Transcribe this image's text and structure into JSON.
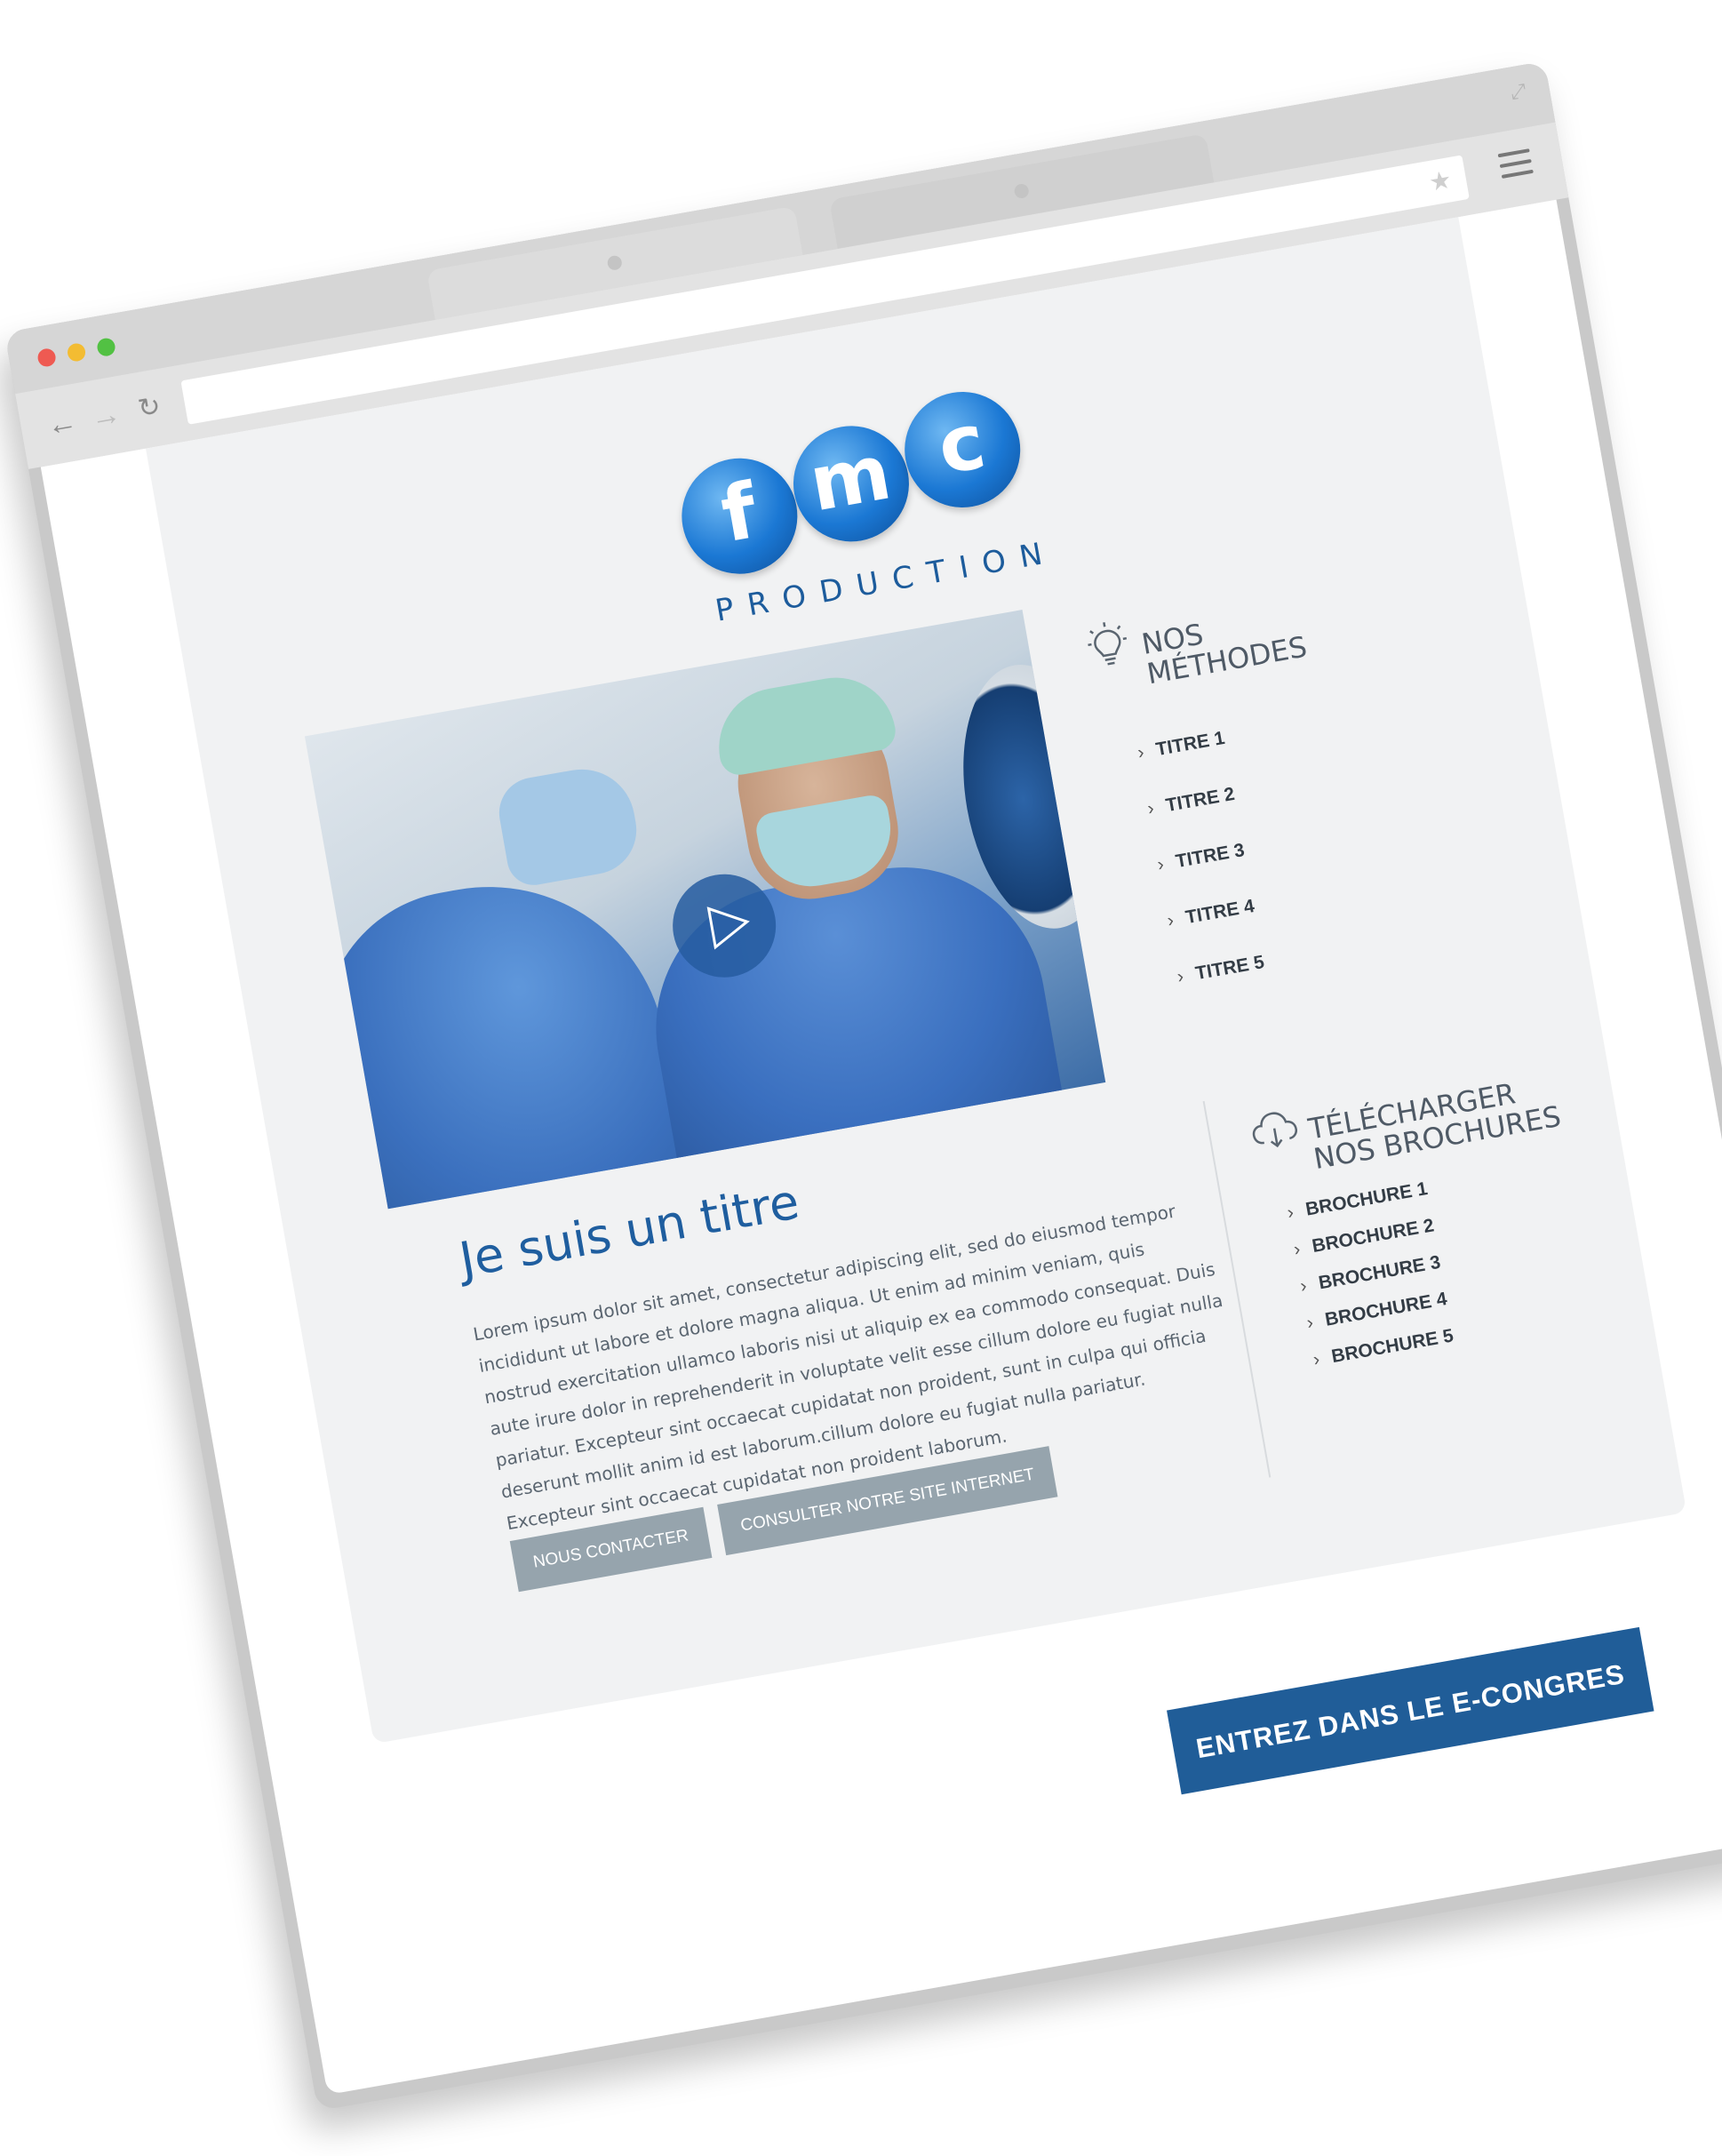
{
  "logo": {
    "letters": [
      "f",
      "m",
      "c"
    ],
    "wordmark": "PRODUCTION"
  },
  "methods": {
    "title": "NOS\nMÉTHODES",
    "items": [
      "TITRE 1",
      "TITRE 2",
      "TITRE 3",
      "TITRE 4",
      "TITRE 5"
    ]
  },
  "brochures": {
    "title": "TÉLÉCHARGER\nNOS BROCHURES",
    "items": [
      "BROCHURE 1",
      "BROCHURE 2",
      "BROCHURE 3",
      "BROCHURE 4",
      "BROCHURE 5"
    ]
  },
  "article": {
    "title": "Je suis un titre",
    "body": "Lorem ipsum dolor sit amet, consectetur adipiscing elit, sed do eiusmod tempor incididunt ut labore et dolore magna aliqua. Ut enim ad minim veniam, quis nostrud exercitation ullamco laboris nisi ut aliquip ex ea commodo consequat. Duis aute irure dolor in reprehenderit in voluptate velit esse cillum dolore eu fugiat nulla pariatur. Excepteur sint occaecat cupidatat non proident, sunt in culpa qui officia deserunt mollit anim id est laborum.cillum dolore eu fugiat nulla pariatur. Excepteur sint occaecat cupidatat non proident laborum."
  },
  "buttons": {
    "contact": "NOUS CONTACTER",
    "website": "CONSULTER NOTRE SITE INTERNET",
    "cta": "ENTREZ DANS LE E-CONGRES"
  },
  "icons": {
    "methods": "lightbulb-icon",
    "brochures": "cloud-download-icon",
    "play": "play-icon"
  },
  "colors": {
    "brand_blue": "#205d98",
    "title_blue": "#1f5e9f",
    "gray_button": "#96a4ad",
    "panel_bg": "#f1f2f3"
  }
}
